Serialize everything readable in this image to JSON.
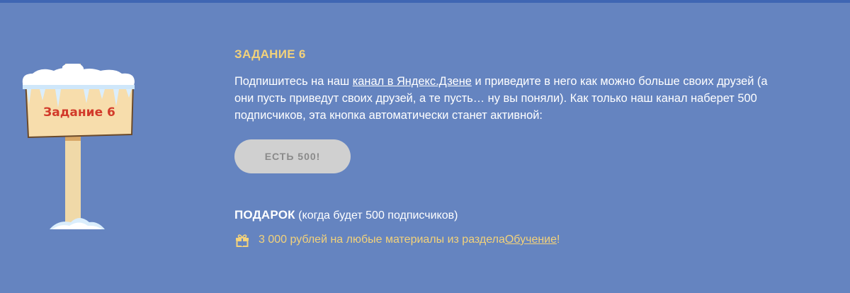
{
  "sign": {
    "label": "Задание 6"
  },
  "task": {
    "title": "ЗАДАНИЕ 6",
    "text_before_link": "Подпишитесь на наш ",
    "link_text": "канал в Яндекс.Дзене",
    "text_after_link": " и приведите в него как можно больше своих друзей (а они пусть приведут своих друзей, а те пусть… ну вы поняли). Как только наш канал наберет 500 подписчиков, эта кнопка автоматически станет активной:",
    "button_label": "ЕСТЬ 500!"
  },
  "gift": {
    "heading": "ПОДАРОК",
    "condition": " (когда будет 500 подписчиков)",
    "text_before_link": "3 000 рублей на любые материалы из раздела ",
    "link_text": "Обучение",
    "text_after_link": "!",
    "icon": "gift-icon"
  },
  "colors": {
    "background": "#6584c0",
    "accent": "#f3d27a",
    "button_bg": "#d0d0d0",
    "button_text": "#8a8a8a"
  }
}
